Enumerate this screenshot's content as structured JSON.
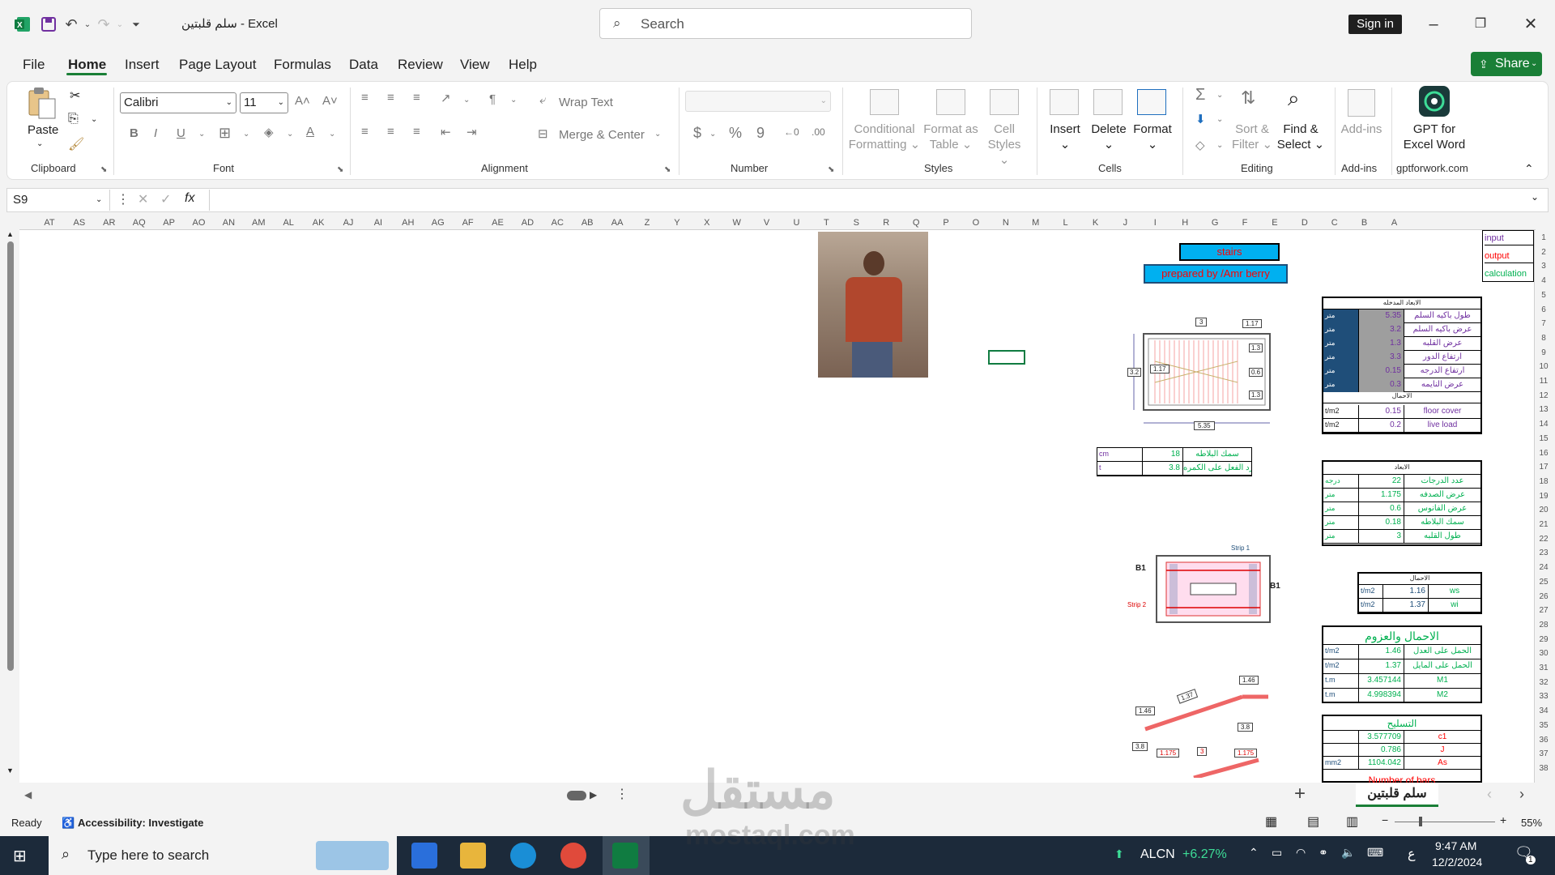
{
  "titlebar": {
    "doc_title": "سلم قلبتين",
    "app": "Excel",
    "separator": "-",
    "search_placeholder": "Search",
    "signin": "Sign in"
  },
  "menu": [
    "File",
    "Home",
    "Insert",
    "Page Layout",
    "Formulas",
    "Data",
    "Review",
    "View",
    "Help"
  ],
  "share": "Share",
  "ribbon": {
    "clipboard": {
      "paste": "Paste",
      "label": "Clipboard"
    },
    "font": {
      "name": "Calibri",
      "size": "11",
      "label": "Font"
    },
    "alignment": {
      "wrap": "Wrap Text",
      "merge": "Merge & Center",
      "label": "Alignment"
    },
    "number": {
      "label": "Number"
    },
    "styles": {
      "cond1": "Conditional",
      "cond2": "Formatting",
      "fat1": "Format as",
      "fat2": "Table",
      "cs1": "Cell",
      "cs2": "Styles",
      "label": "Styles"
    },
    "cells": {
      "insert": "Insert",
      "delete": "Delete",
      "format": "Format",
      "label": "Cells"
    },
    "editing": {
      "sort1": "Sort &",
      "sort2": "Filter",
      "find1": "Find &",
      "find2": "Select",
      "label": "Editing"
    },
    "addins": {
      "btn": "Add-ins",
      "label": "Add-ins"
    },
    "gpt": {
      "l1": "GPT for",
      "l2": "Excel Word",
      "label": "gptforwork.com"
    }
  },
  "formula_bar": {
    "namebox": "S9",
    "fx": "fx"
  },
  "columns": [
    "AT",
    "AS",
    "AR",
    "AQ",
    "AP",
    "AO",
    "AN",
    "AM",
    "AL",
    "AK",
    "AJ",
    "AI",
    "AH",
    "AG",
    "AF",
    "AE",
    "AD",
    "AC",
    "AB",
    "AA",
    "Z",
    "Y",
    "X",
    "W",
    "V",
    "U",
    "T",
    "S",
    "R",
    "Q",
    "P",
    "O",
    "N",
    "M",
    "L",
    "K",
    "J",
    "I",
    "H",
    "G",
    "F",
    "E",
    "D",
    "C",
    "B",
    "A"
  ],
  "rows": [
    "1",
    "2",
    "3",
    "4",
    "5",
    "6",
    "7",
    "8",
    "9",
    "10",
    "11",
    "12",
    "13",
    "14",
    "15",
    "16",
    "17",
    "18",
    "19",
    "20",
    "21",
    "22",
    "23",
    "24",
    "25",
    "26",
    "27",
    "28",
    "29",
    "30",
    "31",
    "32",
    "33",
    "34",
    "35",
    "36",
    "37",
    "38"
  ],
  "sheet": {
    "legend": [
      "input",
      "output",
      "calculation"
    ],
    "header1": "stairs",
    "header2": "prepared by /Amr berry",
    "input_title": "الابعاد المدخله",
    "inputs": [
      {
        "label": "طول باكيه السلم",
        "value": "5.35",
        "unit": "متر"
      },
      {
        "label": "عرض باكيه السلم",
        "value": "3.2",
        "unit": "متر"
      },
      {
        "label": "عرض القلبه",
        "value": "1.3",
        "unit": "متر"
      },
      {
        "label": "ارتفاع الدور",
        "value": "3.3",
        "unit": "متر"
      },
      {
        "label": "ارتفاع الدرجه",
        "value": "0.15",
        "unit": "متر"
      },
      {
        "label": "عرض النايمه",
        "value": "0.3",
        "unit": "متر"
      }
    ],
    "loads_title": "الاحمال",
    "loads": [
      {
        "label": "floor cover",
        "value": "0.15",
        "unit": "t/m2"
      },
      {
        "label": "live load",
        "value": "0.2",
        "unit": "t/m2"
      }
    ],
    "slab": [
      {
        "label": "سمك البلاطه",
        "value": "18",
        "unit": "cm"
      },
      {
        "label": "رد الفعل على الكمره",
        "value": "3.8",
        "unit": "t"
      }
    ],
    "dims_title": "الابعاد",
    "dims": [
      {
        "label": "عدد الدرجات",
        "value": "22",
        "unit": "درجه"
      },
      {
        "label": "عرض الصدفه",
        "value": "1.175",
        "unit": "متر"
      },
      {
        "label": "عرض الفانوس",
        "value": "0.6",
        "unit": "متر"
      },
      {
        "label": "سمك البلاطه",
        "value": "0.18",
        "unit": "متر"
      },
      {
        "label": "طول القلبه",
        "value": "3",
        "unit": "متر"
      }
    ],
    "w_title": "الاحمال",
    "w": [
      {
        "label": "ws",
        "value": "1.16",
        "unit": "t/m2"
      },
      {
        "label": "wi",
        "value": "1.37",
        "unit": "t/m2"
      }
    ],
    "moments_title": "الاحمال والعزوم",
    "moments": [
      {
        "label": "الحمل على العدل",
        "value": "1.46",
        "unit": "t/m2"
      },
      {
        "label": "الحمل على المايل",
        "value": "1.37",
        "unit": "t/m2"
      },
      {
        "label": "M1",
        "value": "3.457144",
        "unit": "t.m"
      },
      {
        "label": "M2",
        "value": "4.998394",
        "unit": "t.m"
      }
    ],
    "rft_title": "التسليح",
    "rft": [
      {
        "label": "c1",
        "value": "3.577709",
        "unit": ""
      },
      {
        "label": "J",
        "value": "0.786",
        "unit": ""
      },
      {
        "label": "As",
        "value": "1104.042",
        "unit": "mm2"
      }
    ],
    "rft_last": "Number of bars",
    "plan_dims": {
      "top": "3",
      "topr": "1.17",
      "left": "3.2",
      "midl": "1.17",
      "r1": "1.3",
      "r2": "0.6",
      "r3": "1.3",
      "bottom": "5.35"
    },
    "strip_labels": {
      "b1l": "B1",
      "b1r": "B1",
      "s1": "Strip 1",
      "s2": "Strip 2"
    },
    "section_vals": {
      "a": "1.46",
      "b": "1.37",
      "c": "1.46",
      "d": "1.46",
      "e": "3.8",
      "f": "3.8",
      "g": "3.8",
      "h": "1.175",
      "i": "3",
      "j": "1.175"
    }
  },
  "sheet_tab": "سلم قلبتين",
  "status": {
    "ready": "Ready",
    "access": "Accessibility: Investigate",
    "zoom": "55%"
  },
  "taskbar": {
    "search": "Type here to search",
    "stock_name": "ALCN",
    "stock_change": "+6.27%",
    "lang": "ع",
    "time": "9:47 AM",
    "date": "12/2/2024",
    "notif": "1"
  },
  "watermark": {
    "ar": "مستقل",
    "en": "mostaql.com"
  },
  "colors": {
    "excel_green": "#1a7f37",
    "header_blue": "#00b0f0",
    "purple_text": "#7030a0",
    "green_text": "#00b050",
    "red_text": "#ff0000"
  }
}
